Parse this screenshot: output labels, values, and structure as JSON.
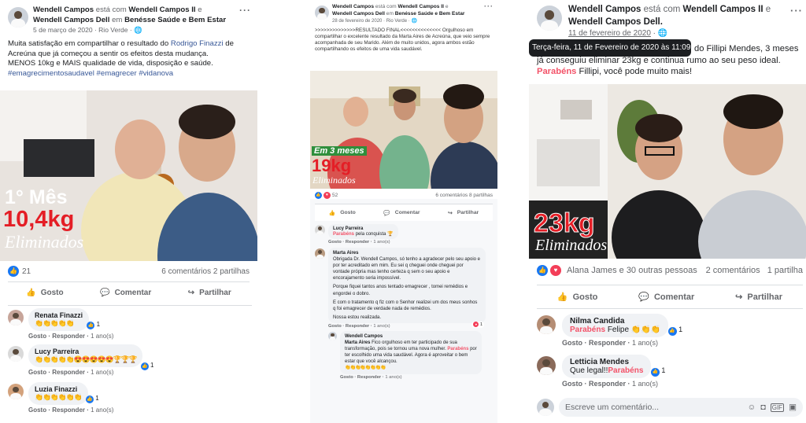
{
  "post1": {
    "author": "Wendell Campos",
    "with_text": "está com",
    "tag1": "Wendell Campos II",
    "and_text": "e",
    "tag2": "Wendell Campos Dell",
    "in_text": "em",
    "place": "Benésse Saúde e Bem Estar",
    "date": "5 de março de 2020",
    "location": "Rio Verde",
    "text_a": "Muita satisfação em compartilhar o resultado do",
    "mention": "Rodrigo Finazzi",
    "text_b": "de Acreúna que já começou a sentir os efeitos desta mudança.",
    "text_c": "MENOS 10kg e MAIS qualidade de vida, disposição e saúde.",
    "hashtags": "#emagrecimentosaudavel #emagrecer #vidanova",
    "photo_line1": "1° Mês",
    "photo_line2": "10,4kg",
    "photo_line3": "Eliminados",
    "reactions": "21",
    "comments_count": "6 comentários",
    "shares": "2 partilhas",
    "actions": {
      "like": "Gosto",
      "comment": "Comentar",
      "share": "Partilhar"
    },
    "comments": [
      {
        "name": "Renata Finazzi",
        "text": "👏👏👏👏👏",
        "react": "1",
        "like": "Gosto",
        "reply": "Responder",
        "time": "1 ano(s)"
      },
      {
        "name": "Lucy Parreira",
        "text": "👏👏👏👏👏😍😍😍😍😍🏆🏆🏆",
        "react": "1",
        "like": "Gosto",
        "reply": "Responder",
        "time": "1 ano(s)"
      },
      {
        "name": "Luzia Finazzi",
        "text": "👏👏👏👏👏👏",
        "react": "1",
        "like": "Gosto",
        "reply": "Responder",
        "time": "1 ano(s)"
      }
    ]
  },
  "post2": {
    "author": "Wendell Campos",
    "with_text": "está com",
    "tag1": "Wendell Campos II",
    "and_text": "e",
    "tag2": "Wendell Campos Dell",
    "in_text": "em",
    "place": "Benésse Saúde e Bem Estar",
    "date": "28 de fevereiro de 2020",
    "location": "Rio Verde",
    "text": ">>>>>>>>>>>>>>RESULTADO FINAL<<<<<<<<<<<<<< Orgulhoso em compartilhar o excelente resultado da Marta Aires de Acreúna, que veio sempre acompanhada de seu Marido. Além de muito unidos, agora ambos estão compartilhando os efeitos de uma vida saudável.",
    "photo_line1": "Em 3 meses",
    "photo_line2": "19kg",
    "photo_line3": "Eliminados",
    "reactions": "52",
    "comments_count": "6 comentários",
    "shares": "8 partilhas",
    "actions": {
      "like": "Gosto",
      "comment": "Comentar",
      "share": "Partilhar"
    },
    "c1": {
      "name": "Lucy Parreira",
      "orange": "Parabéns",
      "text": "pela conquista 🏆",
      "like": "Gosto",
      "reply": "Responder",
      "time": "1 ano(s)"
    },
    "c2": {
      "name": "Marta Aires",
      "p1": "Obrigada Dr. Wendell Campos, só tenho a agradecer pelo seu apoio e por ter acreditado em mim. Eu sei q cheguei onde cheguei por vontade própria mas tenho certeza q sem o seu apoio e encorajamento seria impossível.",
      "p2": "Porque fiquei tantos anos tentado emagrecer , tomei remédios e engordei o dobro.",
      "p3": "E com o tratamento q fiz com o Senhor realizei um dos meus sonhos q foi emagrecer de verdade nada de remédios.",
      "p4": "Nossa estou realizada.",
      "react": "1",
      "like": "Gosto",
      "reply": "Responder",
      "time": "1 ano(s)"
    },
    "c3": {
      "name": "Wendell Campos",
      "mention": "Marta Aires",
      "t1": "Fico orgulhoso em ter participado de sua transformação, pois se tornou uma nova mulher.",
      "orange": "Parabéns",
      "t2": "por ter escolhido uma vida saudável. Agora é aproveitar o bem estar que você alcançou.",
      "emoji": "👏👏👏👏👏👏👏👏",
      "like": "Gosto",
      "reply": "Responder",
      "time": "1 ano(s)"
    }
  },
  "post3": {
    "author": "Wendell Campos",
    "with_text": "está com",
    "tag1": "Wendell Campos II",
    "and_text": "e",
    "tag2": "Wendell Campos Dell.",
    "date": "11 de fevereiro de 2020",
    "tooltip": "Terça-feira, 11 de Fevereiro de 2020 às 11:09",
    "text_a": "do Fillipi Mendes, 3 meses",
    "text_b": "já conseguiu eliminar 23kg e continua rumo ao seu peso ideal.",
    "orange": "Parabéns",
    "text_c": "Fillipi, você pode muito mais!",
    "photo_line1": "23kg",
    "photo_line2": "Eliminados",
    "reactions": "Alana James e 30 outras pessoas",
    "comments_count": "2 comentários",
    "shares": "1 partilha",
    "actions": {
      "like": "Gosto",
      "comment": "Comentar",
      "share": "Partilhar"
    },
    "comments": [
      {
        "name": "Nilma Candida",
        "orange": "Parabéns",
        "text": "Felipe 👏👏👏",
        "react": "1",
        "like": "Gosto",
        "reply": "Responder",
        "time": "1 ano(s)"
      },
      {
        "name": "Letticia Mendes",
        "text": "Que legal!!",
        "orange": "Parabéns",
        "react": "1",
        "like": "Gosto",
        "reply": "Responder",
        "time": "1 ano(s)"
      }
    ],
    "composer_placeholder": "Escreve um comentário..."
  },
  "colors": {
    "brand_blue": "#1877f2",
    "link": "#385898",
    "orange": "#f35369",
    "heart": "#f33e58"
  }
}
